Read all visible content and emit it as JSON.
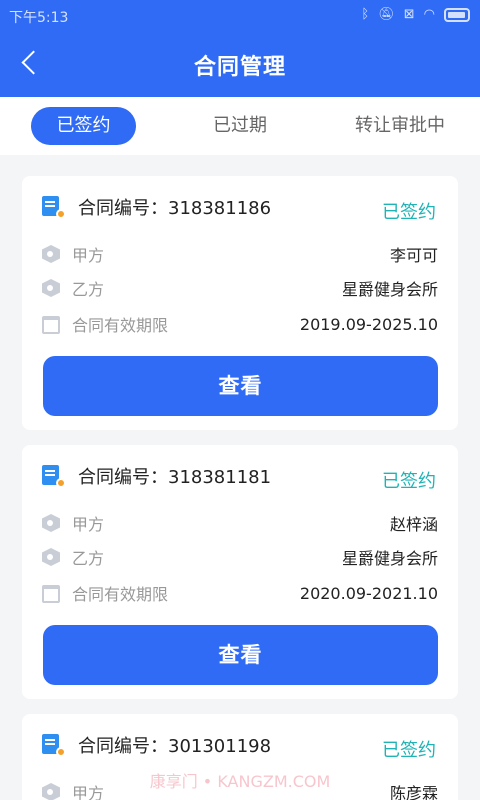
{
  "status_bar": {
    "time": "下午5:13"
  },
  "header": {
    "title": "合同管理"
  },
  "tabs": [
    {
      "label": "已签约",
      "active": true
    },
    {
      "label": "已过期",
      "active": false
    },
    {
      "label": "转让审批中",
      "active": false
    }
  ],
  "fields": {
    "party_a": "甲方",
    "party_b": "乙方",
    "validity": "合同有效期限"
  },
  "view_button_label": "查看",
  "contracts": [
    {
      "number": "合同编号：318381186",
      "status": "已签约",
      "party_a": "李可可",
      "party_b": "星爵健身会所",
      "period": "2019.09-2025.10"
    },
    {
      "number": "合同编号：318381181",
      "status": "已签约",
      "party_a": "赵梓涵",
      "party_b": "星爵健身会所",
      "period": "2020.09-2021.10"
    },
    {
      "number": "合同编号：301301198",
      "status": "已签约",
      "party_a": "陈彦霖"
    }
  ],
  "watermark": "康享门 • KANGZM.COM",
  "colors": {
    "primary": "#2f6bf4",
    "status": "#1fb3b6"
  }
}
